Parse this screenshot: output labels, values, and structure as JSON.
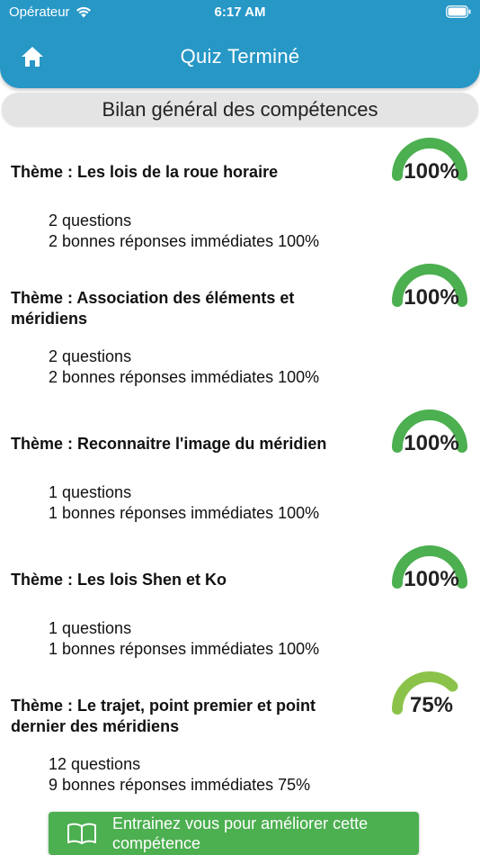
{
  "status_bar": {
    "carrier": "Opérateur",
    "time": "6:17 AM"
  },
  "header": {
    "title": "Quiz Terminé"
  },
  "summary": {
    "title": "Bilan général des compétences"
  },
  "themes": [
    {
      "name": "Thème : Les lois de la roue horaire",
      "percent_label": "100%",
      "score": 1.0,
      "questions": "2 questions",
      "good_answers": "2 bonnes réponses immédiates 100%"
    },
    {
      "name": "Thème : Association des éléments et méridiens",
      "percent_label": "100%",
      "score": 1.0,
      "questions": "2 questions",
      "good_answers": "2 bonnes réponses immédiates 100%"
    },
    {
      "name": "Thème : Reconnaitre l'image du méridien",
      "percent_label": "100%",
      "score": 1.0,
      "questions": "1 questions",
      "good_answers": "1 bonnes réponses immédiates 100%"
    },
    {
      "name": "Thème : Les lois Shen et Ko",
      "percent_label": "100%",
      "score": 1.0,
      "questions": "1 questions",
      "good_answers": "1 bonnes réponses immédiates 100%"
    },
    {
      "name": "Thème : Le trajet, point premier et point dernier des méridiens",
      "percent_label": "75%",
      "score": 0.75,
      "questions": "12 questions",
      "good_answers": "9 bonnes réponses immédiates 75%"
    }
  ],
  "train_button": {
    "label": "Entrainez vous pour améliorer cette compétence"
  },
  "colors": {
    "header": "#2797c6",
    "gauge_full": "#4caf50",
    "gauge_partial": "#8bc34a",
    "button": "#4caf50"
  }
}
